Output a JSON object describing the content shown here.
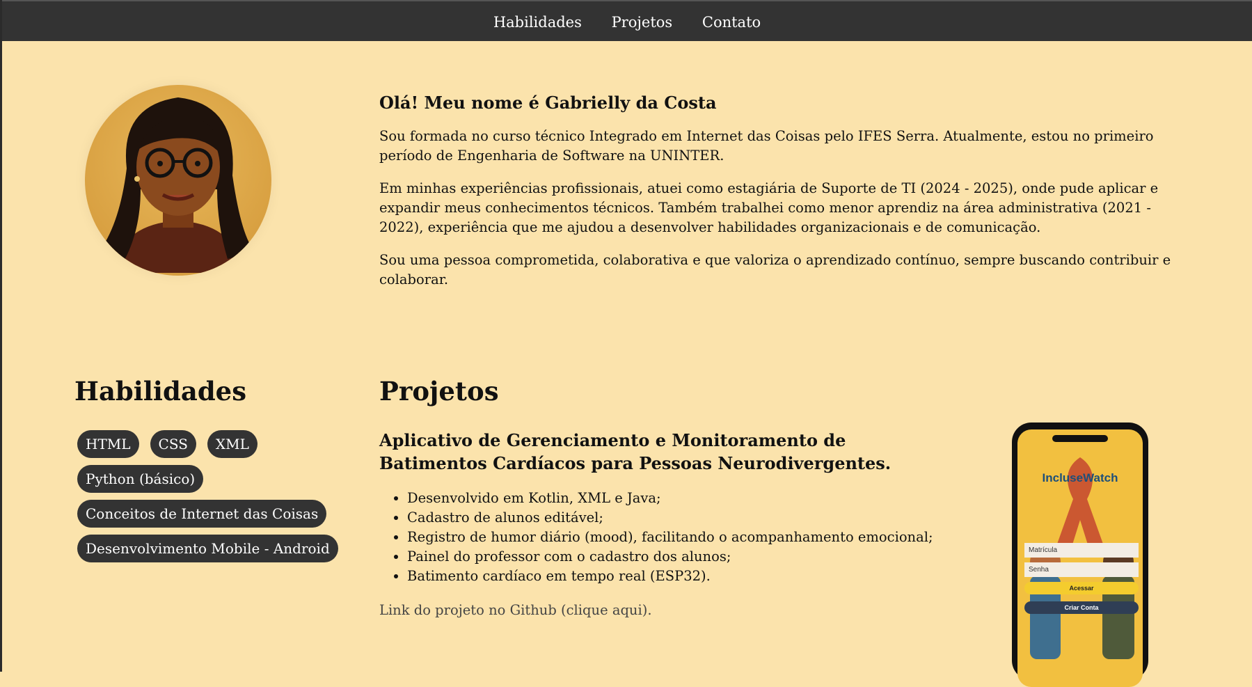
{
  "nav": {
    "items": [
      "Habilidades",
      "Projetos",
      "Contato"
    ]
  },
  "about": {
    "heading": "Olá! Meu nome é Gabrielly da Costa",
    "paragraphs": [
      "Sou formada no curso técnico Integrado em Internet das Coisas pelo IFES Serra. Atualmente, estou no primeiro período de Engenharia de Software na UNINTER.",
      "Em minhas experiências profissionais, atuei como estagiária de Suporte de TI (2024 - 2025), onde pude aplicar e expandir meus conhecimentos técnicos. Também trabalhei como menor aprendiz na área administrativa (2021 - 2022), experiência que me ajudou a desenvolver habilidades organizacionais e de comunicação.",
      "Sou uma pessoa comprometida, colaborativa e que valoriza o aprendizado contínuo, sempre buscando contribuir e colaborar."
    ]
  },
  "skills": {
    "title": "Habilidades",
    "items": [
      "HTML",
      "CSS",
      "XML",
      "Python (básico)",
      "Conceitos de Internet das Coisas",
      "Desenvolvimento Mobile - Android"
    ]
  },
  "projects": {
    "title": "Projetos",
    "project_title": "Aplicativo de Gerenciamento e Monitoramento de Batimentos Cardíacos para Pessoas Neurodivergentes.",
    "features": [
      "Desenvolvido em Kotlin, XML e Java;",
      "Cadastro de alunos editável;",
      "Registro de humor diário (mood), facilitando o acompanhamento emocional;",
      "Painel do professor com o cadastro dos alunos;",
      "Batimento cardíaco em tempo real (ESP32)."
    ],
    "link_text": "Link do projeto no Github (clique aqui).",
    "phone": {
      "app_name": "IncluseWatch",
      "field_1": "Matrícula",
      "field_2": "Senha",
      "primary_button": "Acessar",
      "secondary_button": "Criar Conta"
    }
  },
  "colors": {
    "background": "#fbe3ac",
    "nav_background": "#333333",
    "pill_background": "#333333"
  }
}
